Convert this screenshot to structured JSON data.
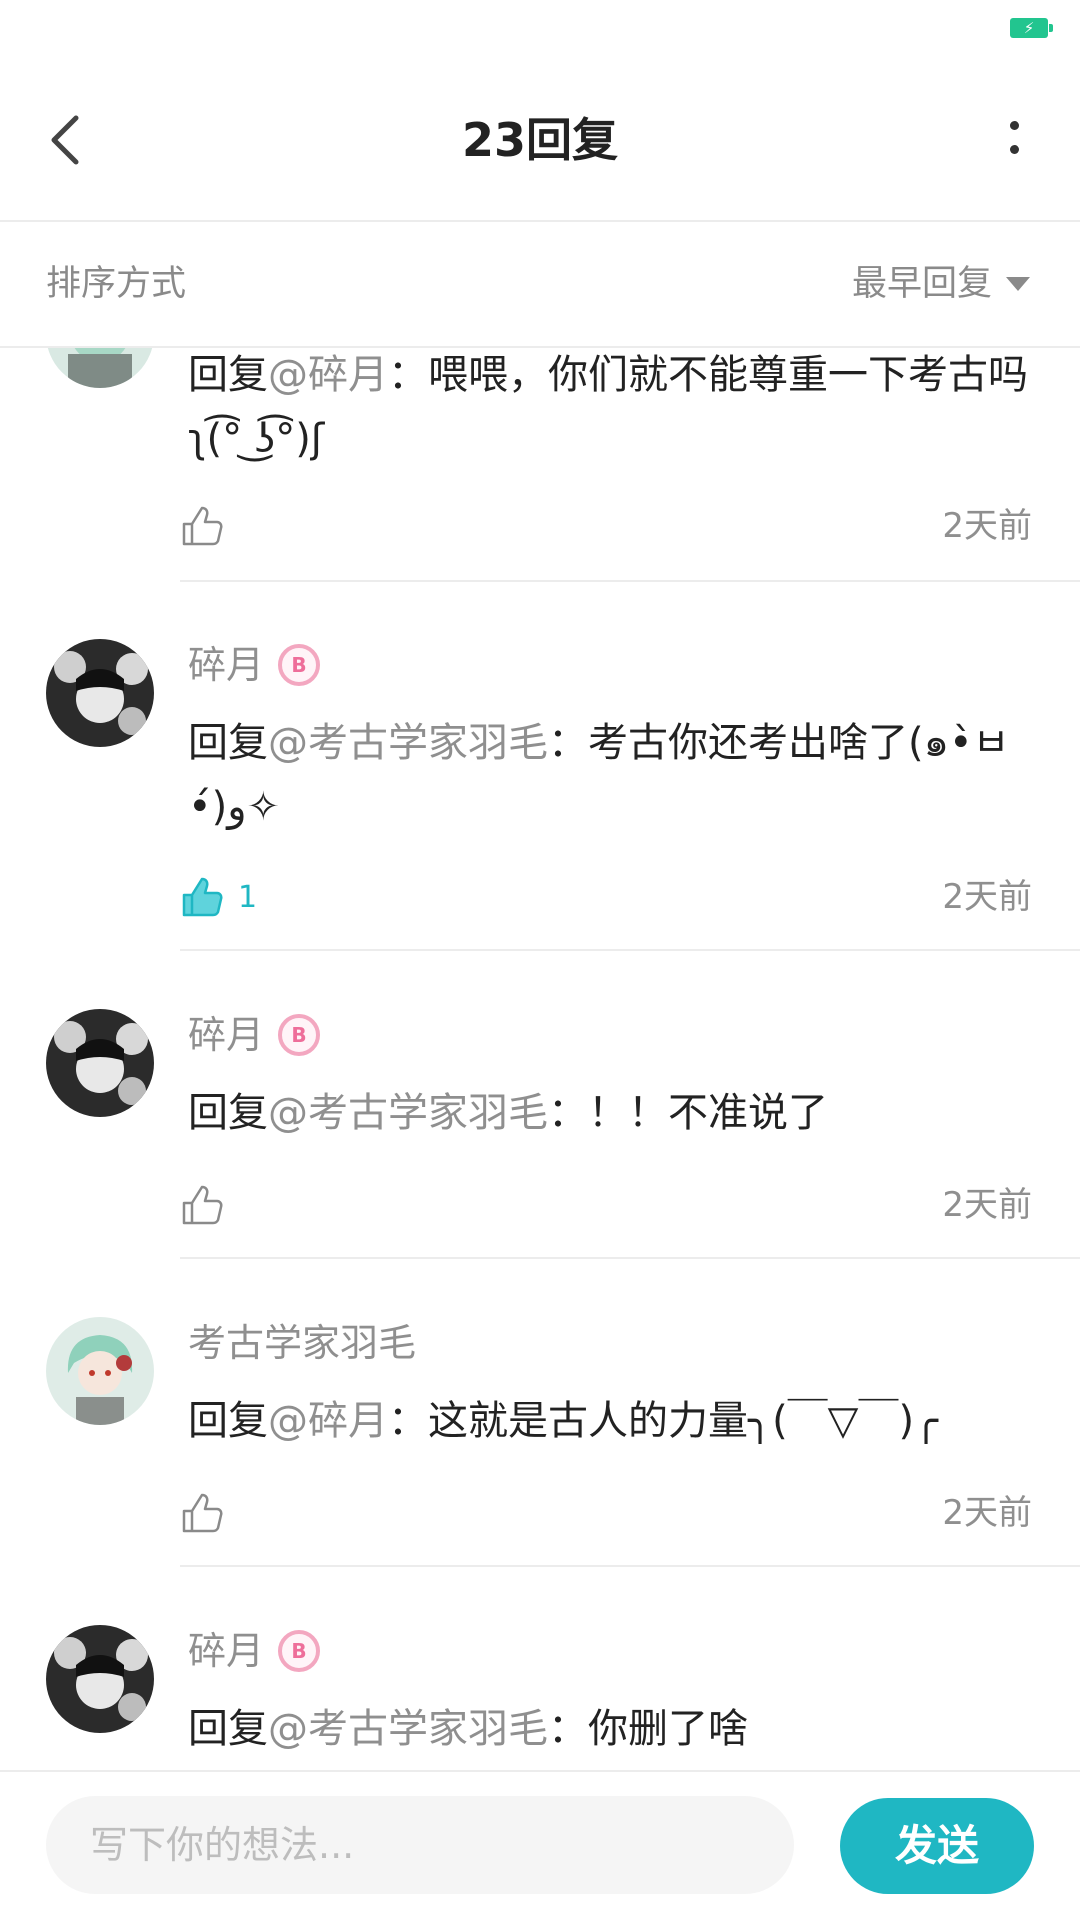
{
  "status_bar": {
    "battery_icon": "charging-battery-icon",
    "accent": "#22c58f"
  },
  "header": {
    "title": "23回复",
    "back_icon": "chevron-left-icon",
    "more_icon": "more-vertical-icon"
  },
  "sort": {
    "label": "排序方式",
    "selected": "最早回复",
    "caret_icon": "caret-down-icon"
  },
  "comments": [
    {
      "author": "",
      "reply_prefix": "回复",
      "mention": "@碎月",
      "separator": "：",
      "text": "喂喂，你们就不能尊重一下考古吗ʅ(͡° ͜ʖ͡°)ʃ",
      "likes": "",
      "liked": false,
      "time": "2天前"
    },
    {
      "author": "碎月",
      "badge_icon": "level-badge-icon",
      "reply_prefix": "回复",
      "mention": "@考古学家羽毛",
      "separator": "：",
      "text": "考古你还考出啥了(๑•̀ㅂ•́)و✧",
      "likes": "1",
      "liked": true,
      "time": "2天前"
    },
    {
      "author": "碎月",
      "badge_icon": "level-badge-icon",
      "reply_prefix": "回复",
      "mention": "@考古学家羽毛",
      "separator": "：",
      "text": "！！不准说了",
      "likes": "",
      "liked": false,
      "time": "2天前"
    },
    {
      "author": "考古学家羽毛",
      "reply_prefix": "回复",
      "mention": "@碎月",
      "separator": "：",
      "text": "这就是古人的力量╮(￣▽￣)╭",
      "likes": "",
      "liked": false,
      "time": "2天前"
    },
    {
      "author": "碎月",
      "badge_icon": "level-badge-icon",
      "reply_prefix": "回复",
      "mention": "@考古学家羽毛",
      "separator": "：",
      "text": "你删了啥",
      "likes": "",
      "liked": false,
      "time": ""
    }
  ],
  "input": {
    "placeholder": "写下你的想法...",
    "value": ""
  },
  "send_label": "发送",
  "colors": {
    "accent": "#1fb7c3",
    "muted_text": "#8f8f8f",
    "badge_pink": "#ee6e9a"
  }
}
